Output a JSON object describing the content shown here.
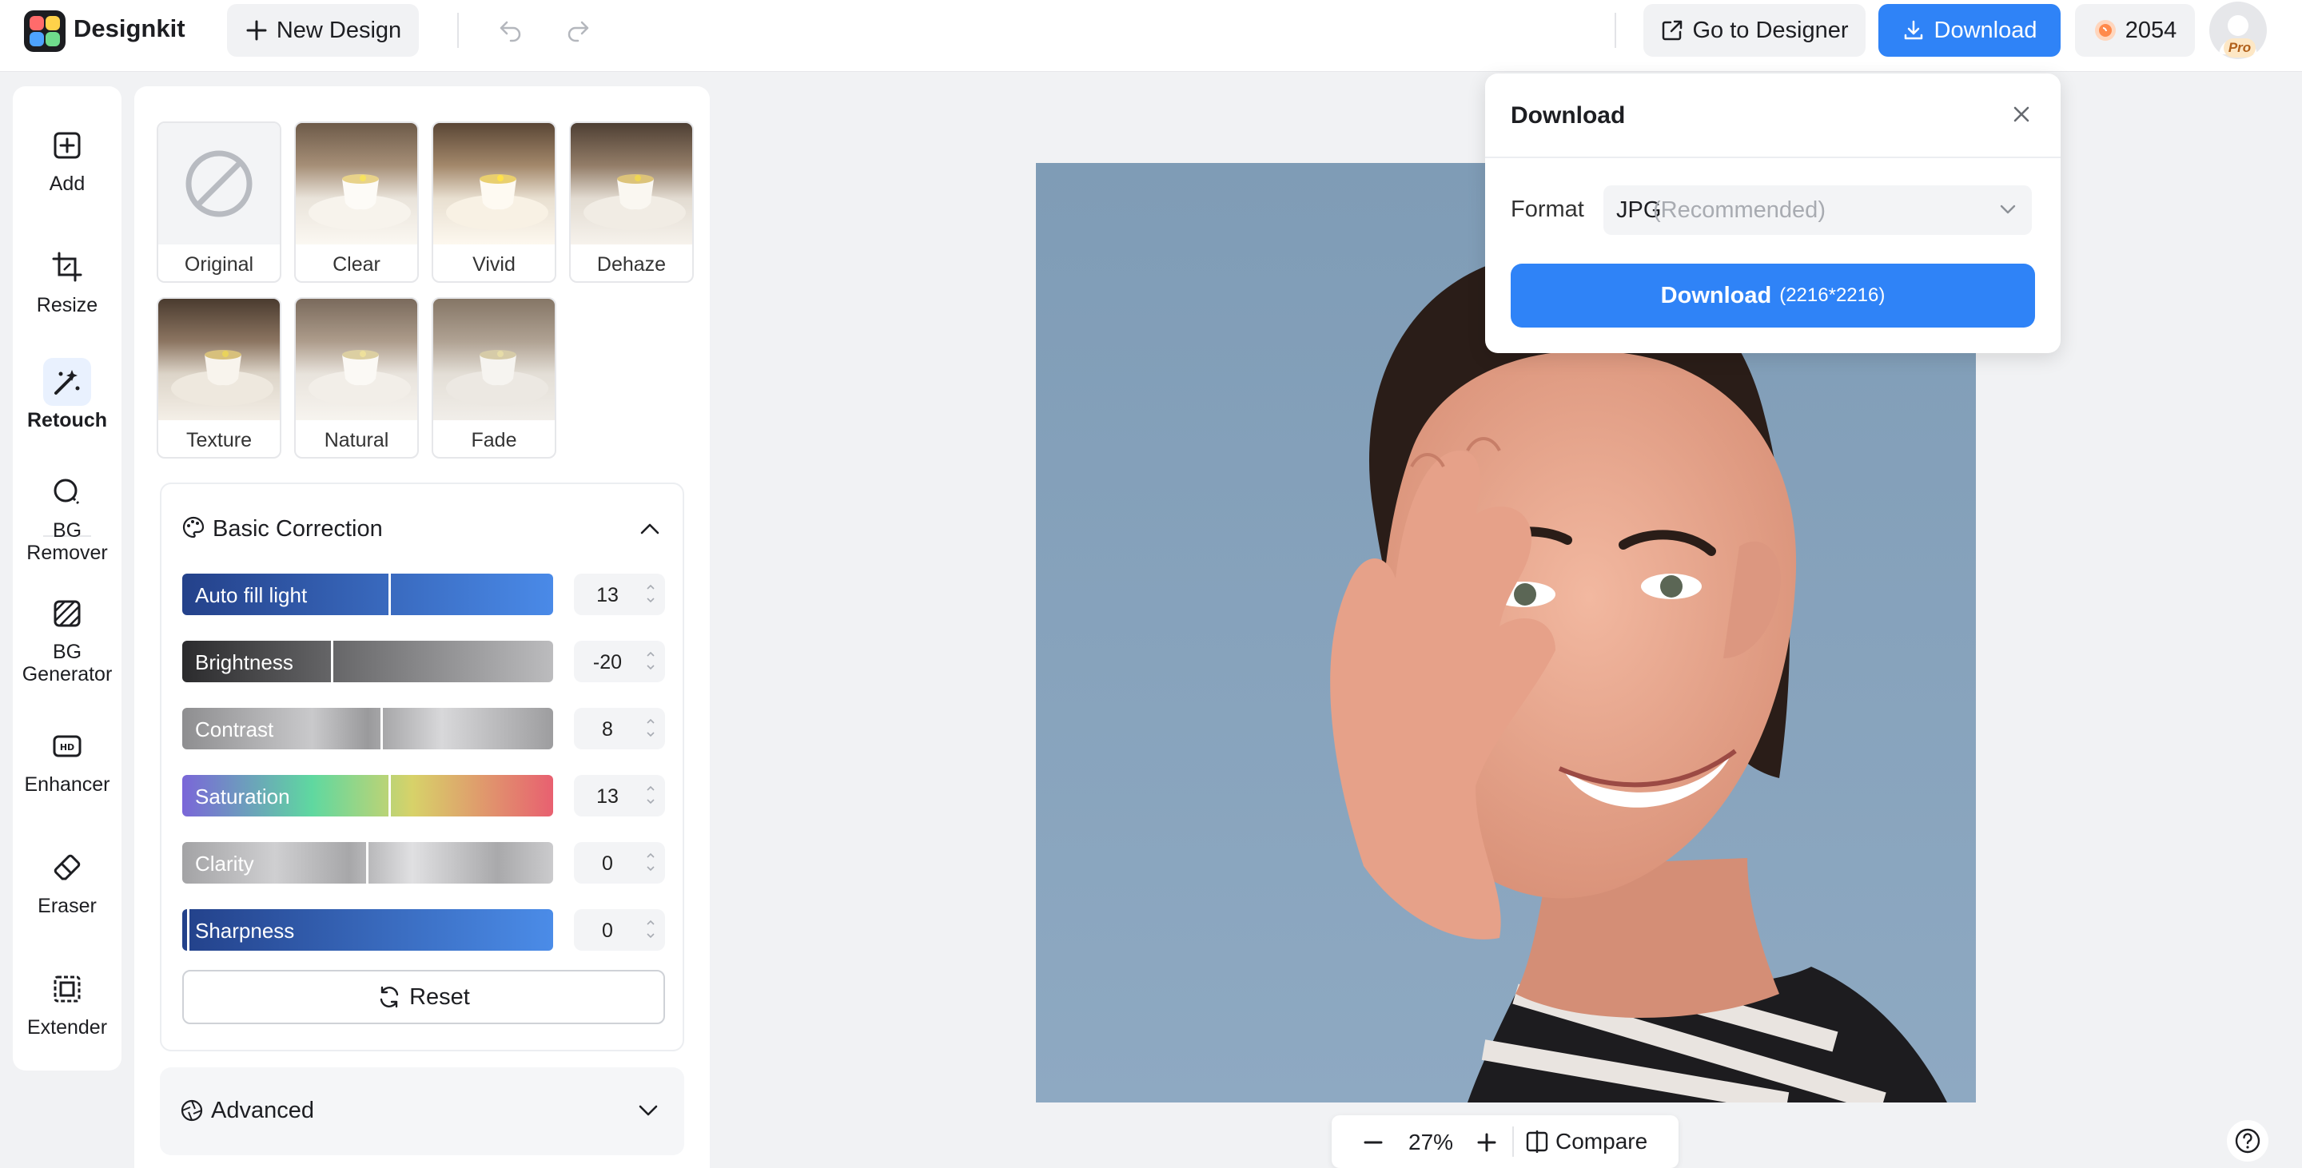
{
  "header": {
    "brand": "Designkit",
    "new_design": "New Design",
    "go_to_designer": "Go to Designer",
    "download": "Download",
    "credits": "2054",
    "pro_badge": "Pro",
    "accent_color": "#2f83f7"
  },
  "sidebar": {
    "items": [
      {
        "label": "Add",
        "icon": "add-square-icon"
      },
      {
        "label": "Resize",
        "icon": "crop-icon"
      },
      {
        "label": "Retouch",
        "icon": "magic-wand-icon",
        "active": true
      },
      {
        "label": "BG Remover",
        "icon": "bg-remover-icon"
      },
      {
        "label": "BG Generator",
        "icon": "bg-generator-icon"
      },
      {
        "label": "Enhancer",
        "icon": "hd-icon"
      },
      {
        "label": "Eraser",
        "icon": "eraser-icon"
      },
      {
        "label": "Extender",
        "icon": "extender-icon"
      }
    ]
  },
  "presets": [
    {
      "label": "Original",
      "selected": true
    },
    {
      "label": "Clear"
    },
    {
      "label": "Vivid"
    },
    {
      "label": "Dehaze"
    },
    {
      "label": "Texture"
    },
    {
      "label": "Natural"
    },
    {
      "label": "Fade"
    }
  ],
  "basic_correction": {
    "title": "Basic Correction",
    "sliders": [
      {
        "label": "Auto fill light",
        "value": "13"
      },
      {
        "label": "Brightness",
        "value": "-20"
      },
      {
        "label": "Contrast",
        "value": "8"
      },
      {
        "label": "Saturation",
        "value": "13"
      },
      {
        "label": "Clarity",
        "value": "0"
      },
      {
        "label": "Sharpness",
        "value": "0"
      }
    ],
    "reset": "Reset"
  },
  "advanced": {
    "title": "Advanced"
  },
  "zoom": {
    "value": "27%",
    "compare": "Compare"
  },
  "download_dialog": {
    "title": "Download",
    "format_label": "Format",
    "format_value": "JPG",
    "format_hint": "(Recommended)",
    "button_label": "Download",
    "button_size": "(2216*2216)"
  }
}
